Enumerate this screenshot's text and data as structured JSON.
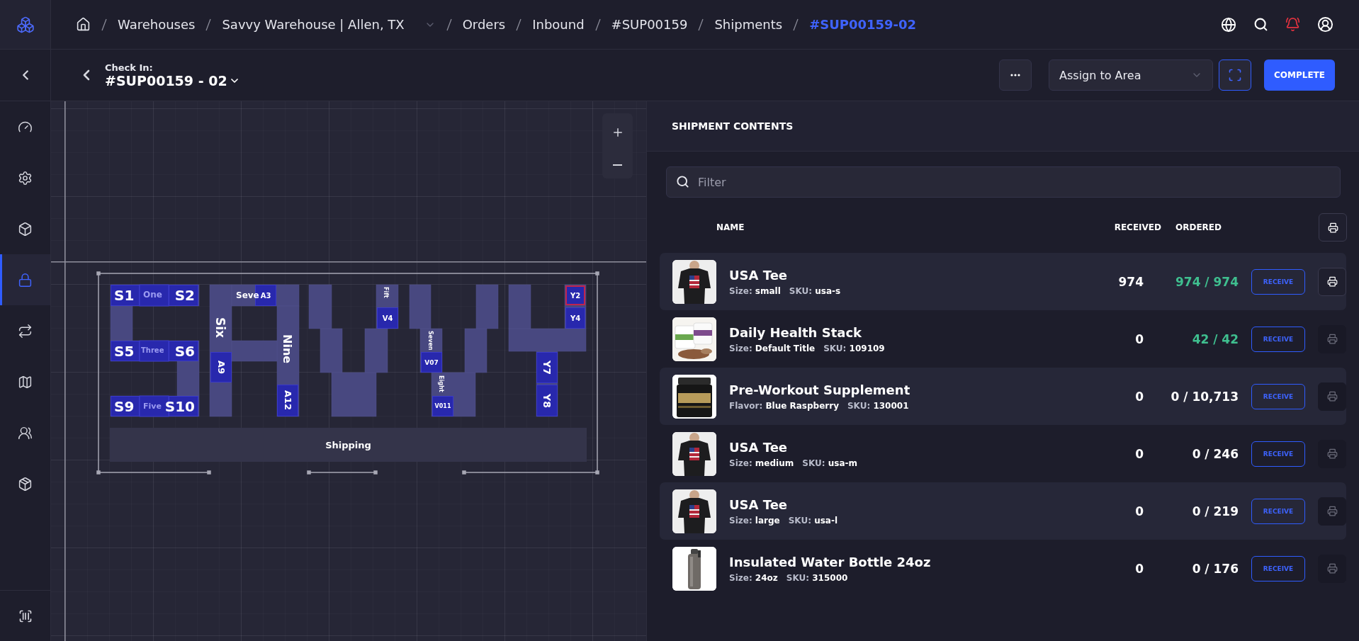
{
  "sidebar": {
    "items": [
      {
        "selected": false
      },
      {
        "selected": false
      },
      {
        "selected": false
      },
      {
        "selected": true
      },
      {
        "selected": false
      },
      {
        "selected": false
      },
      {
        "selected": false
      },
      {
        "selected": false
      }
    ]
  },
  "breadcrumbs": [
    {
      "kind": "home",
      "selected": false
    },
    {
      "kind": "link",
      "label": "Warehouses",
      "selected": false
    },
    {
      "kind": "link",
      "label": "Savvy Warehouse | Allen, TX",
      "selected": false,
      "has_dropdown": true
    },
    {
      "kind": "link",
      "label": "Orders",
      "selected": false
    },
    {
      "kind": "link",
      "label": "Inbound",
      "selected": false
    },
    {
      "kind": "link",
      "label": "#SUP00159",
      "selected": false
    },
    {
      "kind": "link",
      "label": "Shipments",
      "selected": false
    },
    {
      "kind": "link",
      "label": "#SUP00159-02",
      "selected": true
    }
  ],
  "header": {
    "caption": "Check In:",
    "title": "#SUP00159 - 02",
    "area_select": {
      "placeholder": "Assign to Area"
    },
    "complete_button": "COMPLETE"
  },
  "map": {
    "zones": [
      {
        "label": "S1",
        "selected": false
      },
      {
        "label": "S2",
        "selected": false
      },
      {
        "label": "S5",
        "selected": false
      },
      {
        "label": "S6",
        "selected": false
      },
      {
        "label": "S9",
        "selected": false
      },
      {
        "label": "S10",
        "selected": false
      },
      {
        "label": "A3",
        "selected": false
      },
      {
        "label": "A9",
        "selected": false
      },
      {
        "label": "A12",
        "selected": false
      },
      {
        "label": "V4",
        "selected": false
      },
      {
        "label": "V07",
        "selected": false
      },
      {
        "label": "V011",
        "selected": false
      },
      {
        "label": "Y2",
        "selected": true
      },
      {
        "label": "Y4",
        "selected": false
      },
      {
        "label": "Y7",
        "selected": false
      },
      {
        "label": "Y8",
        "selected": false
      }
    ],
    "area_labels": [
      "One",
      "Three",
      "Five",
      "Seve",
      "Six",
      "Nine",
      "Fift",
      "Seven",
      "Eight"
    ],
    "shipping": "Shipping"
  },
  "contents": {
    "title": "SHIPMENT CONTENTS",
    "filter": {
      "placeholder": "Filter"
    },
    "columns": [
      "NAME",
      "RECEIVED",
      "ORDERED"
    ],
    "rows": [
      {
        "thumb": {
          "kind": "picture"
        },
        "name": "USA Tee",
        "details": [
          "Size: **small**",
          "SKU: **usa-s**"
        ],
        "received": "974",
        "ordered": "974 / 974",
        "complete": true,
        "action": "RECEIVE",
        "print_enabled": true
      },
      {
        "thumb": {
          "kind": "picture"
        },
        "name": "Daily Health Stack",
        "details": [
          "Size: **Default Title**",
          "SKU: **109109**"
        ],
        "received": "0",
        "ordered": "42 / 42",
        "complete": true,
        "action": "RECEIVE",
        "print_enabled": false
      },
      {
        "thumb": {
          "kind": "picture"
        },
        "name": "Pre-Workout Supplement",
        "details": [
          "Flavor: **Blue Raspberry**",
          "SKU: **130001**"
        ],
        "received": "0",
        "ordered": "0 / 10,713",
        "complete": false,
        "action": "RECEIVE",
        "print_enabled": false
      },
      {
        "thumb": {
          "kind": "picture"
        },
        "name": "USA Tee",
        "details": [
          "Size: **medium**",
          "SKU: **usa-m**"
        ],
        "received": "0",
        "ordered": "0 / 246",
        "complete": false,
        "action": "RECEIVE",
        "print_enabled": false
      },
      {
        "thumb": {
          "kind": "picture"
        },
        "name": "USA Tee",
        "details": [
          "Size: **large**",
          "SKU: **usa-l**"
        ],
        "received": "0",
        "ordered": "0 / 219",
        "complete": false,
        "action": "RECEIVE",
        "print_enabled": false
      },
      {
        "thumb": {
          "kind": "picture"
        },
        "name": "Insulated Water Bottle 24oz",
        "details": [
          "Size: **24oz**",
          "SKU: **315000**"
        ],
        "received": "0",
        "ordered": "0 / 176",
        "complete": false,
        "action": "RECEIVE",
        "print_enabled": false
      }
    ]
  }
}
